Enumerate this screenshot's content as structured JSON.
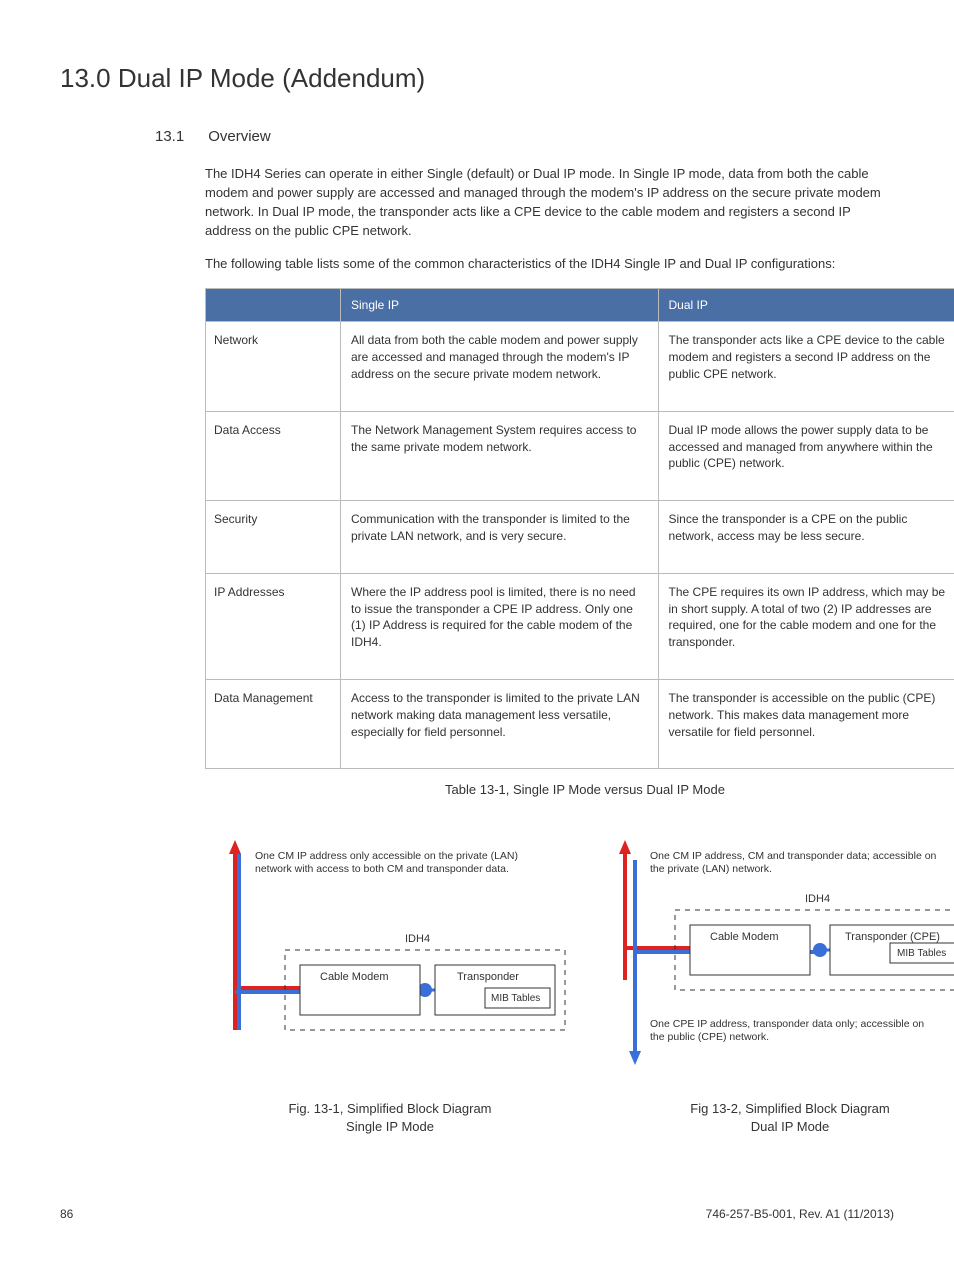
{
  "main_title": "13.0 Dual IP Mode (Addendum)",
  "sec": {
    "num": "13.1",
    "title": "Overview",
    "para1": "The IDH4 Series can operate in either Single (default) or Dual IP mode. In Single IP mode, data from both the cable modem and power supply are accessed and managed through the modem's IP address on the secure private modem network. In Dual IP mode, the transponder acts like a CPE device to the cable modem and registers a second IP address on the public CPE network.",
    "para2": "The following table lists some of the common characteristics of the IDH4 Single IP and Dual IP configurations:"
  },
  "table": {
    "headers": {
      "col1": "",
      "col2": "Single IP",
      "col3": "Dual IP"
    },
    "rows": [
      {
        "label": "Network",
        "single": "All data from both the cable modem and power supply are accessed and managed through the modem's IP address on the secure private modem network.",
        "dual": "The transponder acts like a CPE device to the cable modem and registers a second IP address on the public CPE network."
      },
      {
        "label": "Data Access",
        "single": "The Network Management System requires access to the same private modem network.",
        "dual": "Dual IP mode allows the power supply data to be accessed and managed from anywhere within the public (CPE) network."
      },
      {
        "label": "Security",
        "single": "Communication with the transponder is limited to the private LAN network, and is very secure.",
        "dual": "Since the transponder is a CPE on the public network, access may be less secure."
      },
      {
        "label": "IP Addresses",
        "single": "Where the IP address pool is limited, there is no need to issue the transponder a CPE IP address. Only one (1) IP Address is required for the cable modem of the IDH4.",
        "dual": "The CPE requires its own IP address, which may be in short supply. A total of two (2) IP addresses are required, one for the cable modem and one for the transponder."
      },
      {
        "label": "Data Management",
        "single": "Access to the transponder is limited to the private LAN network making data management less versatile, especially for field personnel.",
        "dual": "The transponder is accessible on the public (CPE) network. This makes data management more versatile for field personnel."
      }
    ],
    "caption": "Table 13-1, Single IP Mode versus Dual IP Mode"
  },
  "fig1": {
    "note": "One CM IP address only accessible on the private (LAN) network with access to both CM and transponder data.",
    "idh4": "IDH4",
    "cm": "Cable Modem",
    "tr": "Transponder",
    "mib": "MIB Tables",
    "caption_l1": "Fig. 13-1, Simplified Block Diagram",
    "caption_l2": "Single IP Mode"
  },
  "fig2": {
    "note_top": "One CM IP address, CM and transponder data; accessible on the private (LAN) network.",
    "idh4": "IDH4",
    "cm": "Cable Modem",
    "tr": "Transponder (CPE)",
    "mib": "MIB Tables",
    "note_bottom": "One CPE IP address, transponder data only; accessible on the public (CPE) network.",
    "caption_l1": "Fig 13-2, Simplified Block Diagram",
    "caption_l2": "Dual IP Mode"
  },
  "footer": {
    "page": "86",
    "rev": "746-257-B5-001, Rev. A1 (11/2013)"
  }
}
